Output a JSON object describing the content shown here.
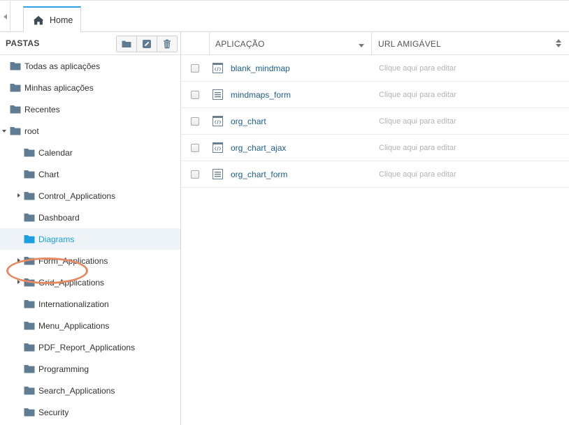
{
  "tabs": {
    "home_label": "Home"
  },
  "sidebar": {
    "title": "PASTAS",
    "tools": [
      "new-folder-icon",
      "edit-icon",
      "trash-icon"
    ],
    "items": [
      {
        "label": "Todas as aplicações",
        "level": 0,
        "arrow": "none",
        "selected": false
      },
      {
        "label": "Minhas aplicações",
        "level": 0,
        "arrow": "none",
        "selected": false
      },
      {
        "label": "Recentes",
        "level": 0,
        "arrow": "none",
        "selected": false
      },
      {
        "label": "root",
        "level": 0,
        "arrow": "down",
        "selected": false
      },
      {
        "label": "Calendar",
        "level": 1,
        "arrow": "none",
        "selected": false
      },
      {
        "label": "Chart",
        "level": 1,
        "arrow": "none",
        "selected": false
      },
      {
        "label": "Control_Applications",
        "level": 1,
        "arrow": "right",
        "selected": false
      },
      {
        "label": "Dashboard",
        "level": 1,
        "arrow": "none",
        "selected": false
      },
      {
        "label": "Diagrams",
        "level": 1,
        "arrow": "none",
        "selected": true
      },
      {
        "label": "Form_Applications",
        "level": 1,
        "arrow": "right",
        "selected": false
      },
      {
        "label": "Grid_Applications",
        "level": 1,
        "arrow": "right",
        "selected": false
      },
      {
        "label": "Internationalization",
        "level": 1,
        "arrow": "none",
        "selected": false
      },
      {
        "label": "Menu_Applications",
        "level": 1,
        "arrow": "none",
        "selected": false
      },
      {
        "label": "PDF_Report_Applications",
        "level": 1,
        "arrow": "none",
        "selected": false
      },
      {
        "label": "Programming",
        "level": 1,
        "arrow": "none",
        "selected": false
      },
      {
        "label": "Search_Applications",
        "level": 1,
        "arrow": "none",
        "selected": false
      },
      {
        "label": "Security",
        "level": 1,
        "arrow": "none",
        "selected": false
      }
    ]
  },
  "grid": {
    "col_app": "APLICAÇÃO",
    "col_url": "URL AMIGÁVEL",
    "rows": [
      {
        "name": "blank_mindmap",
        "icon": "code-app-icon",
        "url": "Clique aqui para editar"
      },
      {
        "name": "mindmaps_form",
        "icon": "form-app-icon",
        "url": "Clique aqui para editar"
      },
      {
        "name": "org_chart",
        "icon": "code-app-icon",
        "url": "Clique aqui para editar"
      },
      {
        "name": "org_chart_ajax",
        "icon": "code-app-icon",
        "url": "Clique aqui para editar"
      },
      {
        "name": "org_chart_form",
        "icon": "form-app-icon",
        "url": "Clique aqui para editar"
      }
    ]
  },
  "colors": {
    "accent": "#1a9fe0",
    "folder": "#5f7c93",
    "link": "#1e5f8a",
    "highlight_ring": "#e38a61"
  }
}
